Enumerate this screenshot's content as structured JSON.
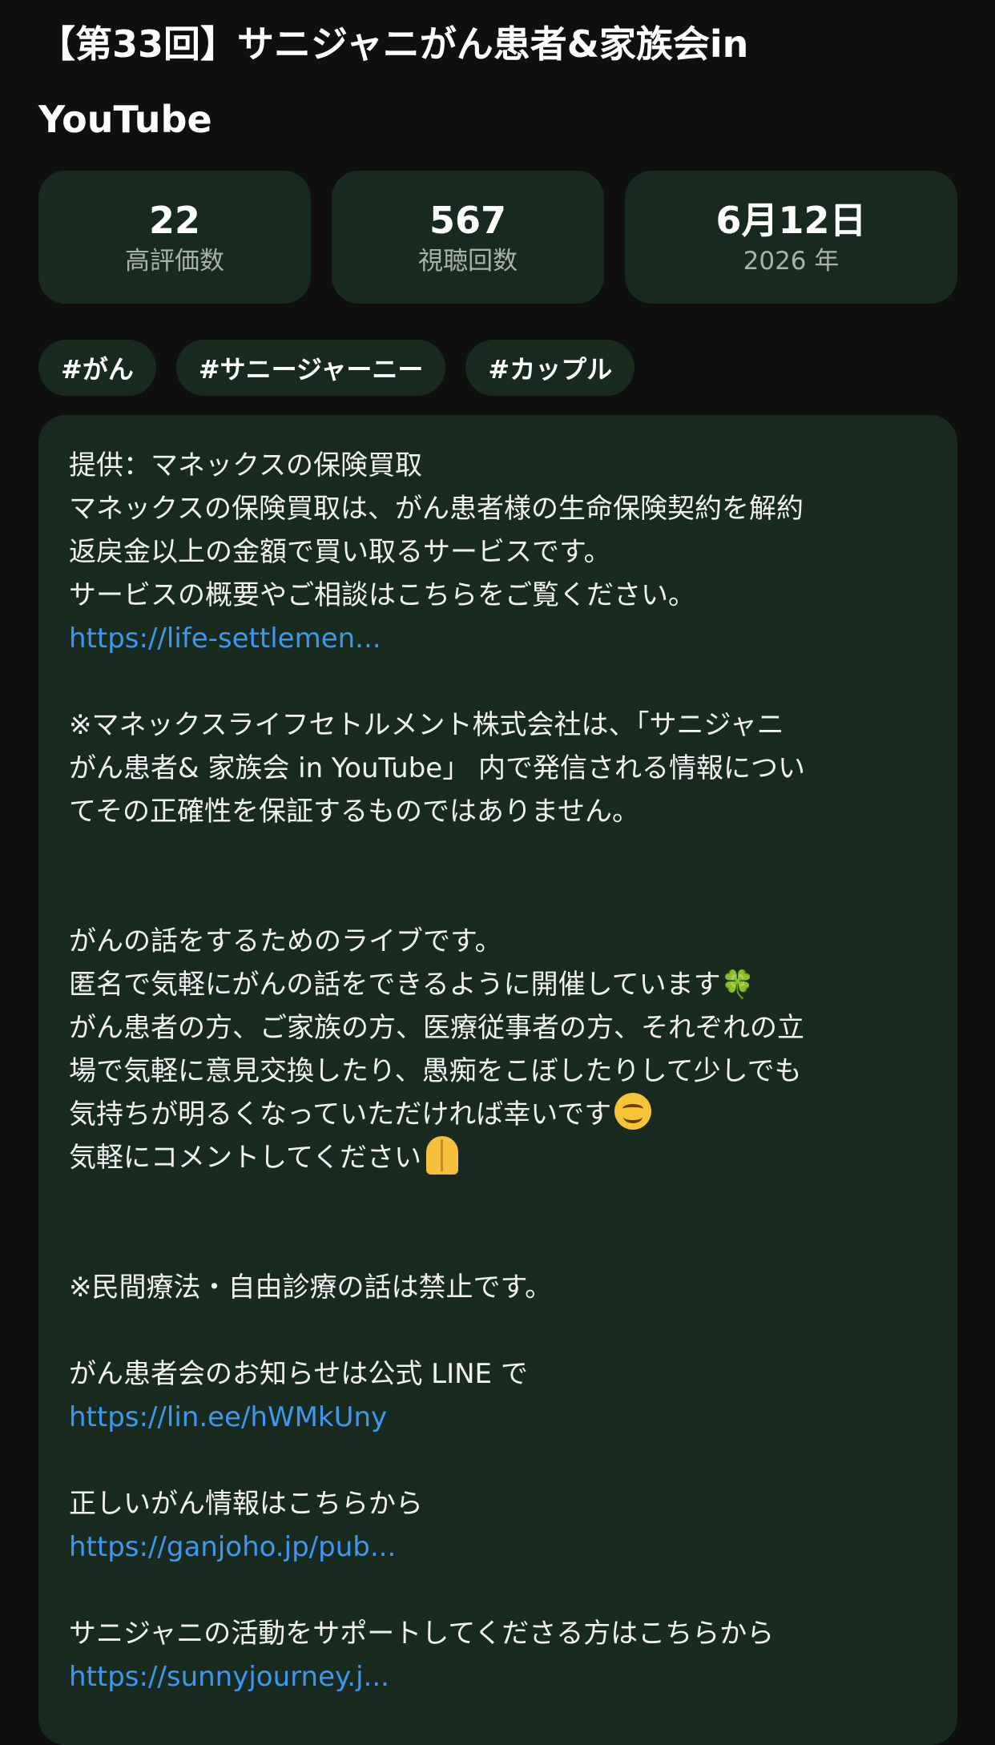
{
  "video": {
    "title_line1": "【第33回】サニジャニがん患者&家族会in",
    "title_line2": "YouTube"
  },
  "stats": {
    "likes": {
      "value": "22",
      "label": "高評価数"
    },
    "views": {
      "value": "567",
      "label": "視聴回数"
    },
    "date": {
      "value": "6月12日",
      "label": "2026 年"
    }
  },
  "tags": [
    "#がん",
    "#サニージャーニー",
    "#カップル"
  ],
  "description": {
    "lines": [
      "提供：マネックスの保険買取",
      "マネックスの保険買取は、がん患者様の生命保険契約を解約",
      "返戻金以上の金額で買い取るサービスです。",
      "サービスの概要やご相談はこちらをご覧ください。",
      "https://life-settlemen...",
      "",
      "※マネックスライフセトルメント株式会社は、「サニジャニ",
      "がん患者& 家族会 in YouTube」 内で発信される情報につい",
      "てその正確性を保証するものではありません。",
      "",
      "",
      "がんの話をするためのライブです。",
      "匿名で気軽にがんの話をできるように開催しています",
      "がん患者の方、ご家族の方、医療従事者の方、それぞれの立",
      "場で気軽に意見交換したり、愚痴をこぼしたりして少しでも",
      "気持ちが明るくなっていただければ幸いです",
      "気軽にコメントしてください",
      "",
      "",
      "※民間療法・自由診療の話は禁止です。",
      "",
      "がん患者会のお知らせは公式 LINE で",
      "https://lin.ee/hWMkUny",
      "",
      "正しいがん情報はこちらから",
      "https://ganjoho.jp/pub...",
      "",
      "サニジャニの活動をサポートしてくださる方はこちらから",
      "https://sunnyjourney.j..."
    ],
    "clover_emoji": "🍀",
    "colors": {
      "link": "#3d97f0",
      "card_bg": "#182a1e",
      "page_bg": "#0f0f0f"
    }
  }
}
